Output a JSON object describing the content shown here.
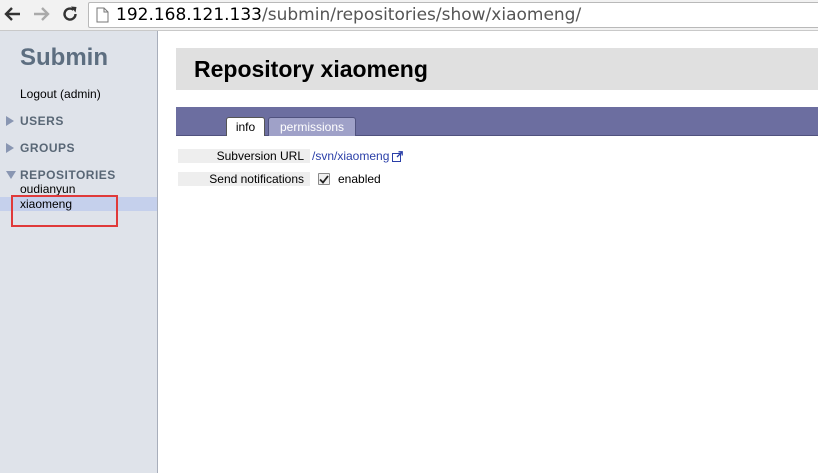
{
  "browser": {
    "url_host": "192.168.121.133",
    "url_path": "/submin/repositories/show/xiaomeng/"
  },
  "sidebar": {
    "brand": "Submin",
    "logout": "Logout (admin)",
    "sections": {
      "users": "USERS",
      "groups": "GROUPS",
      "repositories": "REPOSITORIES"
    },
    "repositories": [
      "oudianyun",
      "xiaomeng"
    ],
    "selected_repository": "xiaomeng"
  },
  "main": {
    "title": "Repository xiaomeng",
    "tabs": [
      {
        "label": "info",
        "active": true
      },
      {
        "label": "permissions",
        "active": false
      }
    ],
    "fields": {
      "svn_label": "Subversion URL",
      "svn_url": "/svn/xiaomeng",
      "notify_label": "Send notifications",
      "notify_checked": true,
      "notify_value": "enabled"
    }
  },
  "colors": {
    "tab_bar": "#6c6ea0",
    "sidebar_bg": "#dfe3ea",
    "selected_row": "#c5d0ec",
    "annotation": "#e03a3a",
    "link": "#2a3fa8"
  },
  "icons": [
    "back-arrow-icon",
    "forward-arrow-icon",
    "reload-icon",
    "page-icon",
    "triangle-right-icon",
    "triangle-down-icon",
    "external-link-icon",
    "checkmark-icon"
  ]
}
